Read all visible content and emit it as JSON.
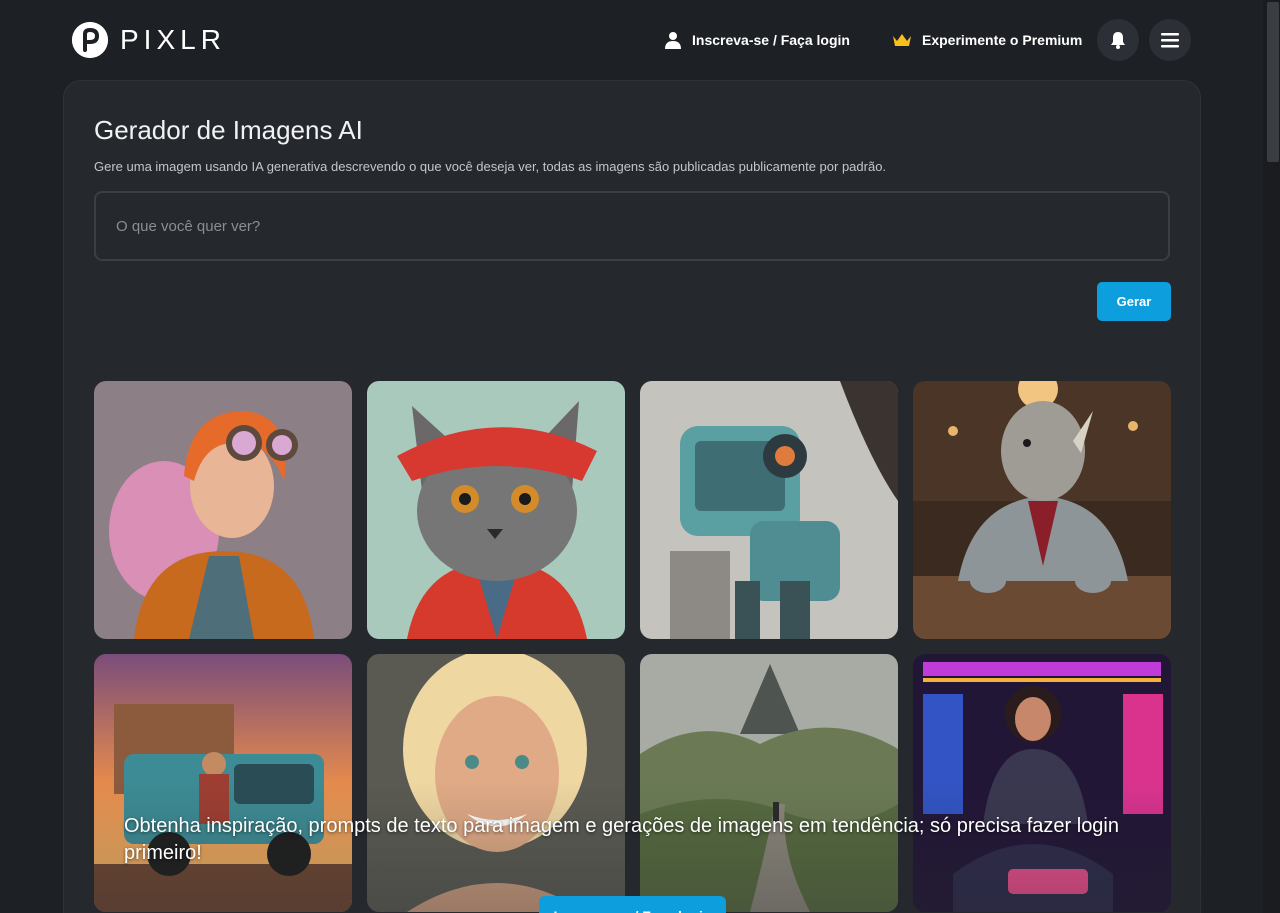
{
  "header": {
    "logo_text": "PIXLR",
    "login_label": "Inscreva-se / Faça login",
    "premium_label": "Experimente o Premium",
    "premium_color": "#f6c01d"
  },
  "generator": {
    "title": "Gerador de Imagens AI",
    "subtitle": "Gere uma imagem usando IA generativa descrevendo o que você deseja ver, todas as imagens são publicadas publicamente por padrão.",
    "prompt_placeholder": "O que você quer ver?",
    "prompt_value": "",
    "generate_label": "Gerar",
    "accent": "#0d9ede"
  },
  "gallery": {
    "items": [
      {
        "icon": "steampunk-girl-image"
      },
      {
        "icon": "cat-in-red-hat-image"
      },
      {
        "icon": "robot-image"
      },
      {
        "icon": "rhino-in-suit-image"
      },
      {
        "icon": "truck-sunset-image"
      },
      {
        "icon": "smiling-woman-image"
      },
      {
        "icon": "mountain-valley-image"
      },
      {
        "icon": "neon-gamer-image"
      }
    ],
    "inspire_text": "Obtenha inspiração, prompts de texto para imagem e gerações de imagens em tendência; só precisa fazer login primeiro!"
  }
}
